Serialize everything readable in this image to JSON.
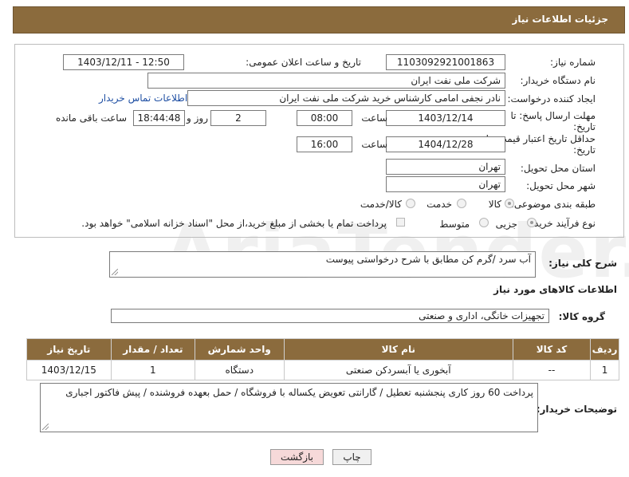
{
  "header": {
    "title": "جزئیات اطلاعات نیاز"
  },
  "form": {
    "need_number_label": "شماره نیاز:",
    "need_number": "1103092921001863",
    "announce_label": "تاریخ و ساعت اعلان عمومی:",
    "announce_value": "1403/12/11 - 12:50",
    "buyer_org_label": "نام دستگاه خریدار:",
    "buyer_org": "شرکت ملی نفت ایران",
    "requester_label": "ایجاد کننده درخواست:",
    "requester": "نادر نجفی امامی کارشناس خرید شرکت ملی نفت ایران",
    "contact_link": "اطلاعات تماس خریدار",
    "reply_deadline_label": "مهلت ارسال پاسخ: تا",
    "reply_deadline_label2": "تاریخ:",
    "reply_date": "1403/12/14",
    "time_label": "ساعت",
    "reply_time": "08:00",
    "days_value": "2",
    "days_label": "روز و",
    "remaining_time": "18:44:48",
    "remaining_label": "ساعت باقی مانده",
    "price_validity_label": "حداقل تاریخ اعتبار قیمت: تا",
    "price_validity_label2": "تاریخ:",
    "validity_date": "1404/12/28",
    "validity_time": "16:00",
    "province_label": "استان محل تحویل:",
    "province": "تهران",
    "city_label": "شهر محل تحویل:",
    "city": "تهران",
    "category_label": "طبقه بندی موضوعی:",
    "category_options": [
      "کالا",
      "خدمت",
      "کالا/خدمت"
    ],
    "process_label": "نوع فرآیند خرید :",
    "process_options": [
      "جزیی",
      "متوسط"
    ],
    "payment_note": "پرداخت تمام یا بخشی از مبلغ خرید،از محل \"اسناد خزانه اسلامی\" خواهد بود."
  },
  "summary": {
    "label": "شرح کلی نیاز:",
    "value": "آب سرد /گرم کن مطابق با شرح درخواستی پیوست"
  },
  "goods_section": {
    "title": "اطلاعات کالاهای مورد نیاز"
  },
  "goods_group": {
    "label": "گروه کالا:",
    "value": "تجهیزات خانگی، اداری و صنعتی"
  },
  "table": {
    "headers": [
      "ردیف",
      "کد کالا",
      "نام کالا",
      "واحد شمارش",
      "تعداد / مقدار",
      "تاریخ نیاز"
    ],
    "rows": [
      [
        "1",
        "--",
        "آبخوری یا آبسردکن صنعتی",
        "دستگاه",
        "1",
        "1403/12/15"
      ]
    ]
  },
  "buyer_notes": {
    "label": "توضیحات خریدار:",
    "value": "پرداخت 60 روز کاری پنجشنبه تعطیل / گارانتی تعویض یکساله با فروشگاه / حمل بعهده فروشنده / پیش فاکتور اجباری"
  },
  "buttons": {
    "print": "چاپ",
    "back": "بازگشت"
  },
  "watermark": "AriaTender.net",
  "colors": {
    "header_bg": "#8b6b3d",
    "link": "#1f4fa3",
    "back_button_bg": "#f6d9d9"
  }
}
